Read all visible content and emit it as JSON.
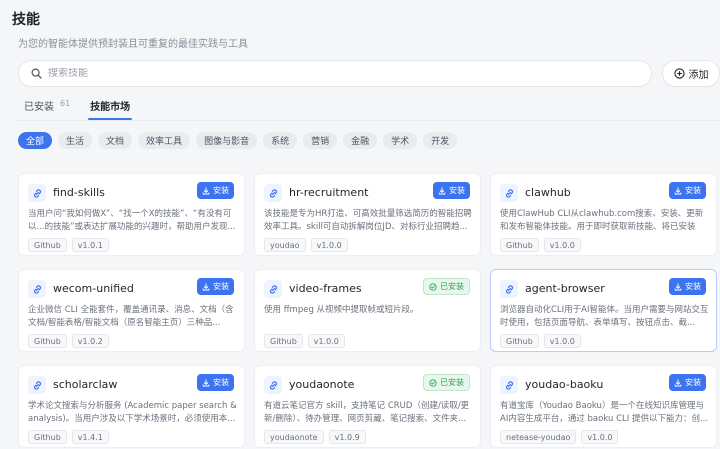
{
  "header": {
    "title": "技能",
    "subtitle": "为您的智能体提供预封装且可重复的最佳实践与工具"
  },
  "search": {
    "placeholder": "搜索技能",
    "value": ""
  },
  "add_button": {
    "label": "添加",
    "icon": "plus-circle-icon"
  },
  "tabs": [
    {
      "label": "已安装",
      "count": "61",
      "active": false
    },
    {
      "label": "技能市场",
      "count": "",
      "active": true
    }
  ],
  "categories": [
    "全部",
    "生活",
    "文档",
    "效率工具",
    "图像与影音",
    "系统",
    "营销",
    "金融",
    "学术",
    "开发"
  ],
  "selected_category": "全部",
  "labels": {
    "install": "安装",
    "installed": "已安装"
  },
  "colors": {
    "accent": "#3b73f0",
    "installed_green": "#2ea05a"
  },
  "cards": [
    {
      "name": "find-skills",
      "desc": "当用户问“我如何做X”、“找一个X的技能”、“有没有可以...的技能”或表达扩展功能的兴趣时，帮助用户发现...",
      "source": "Github",
      "version": "v1.0.1",
      "status": "install"
    },
    {
      "name": "hr-recruitment",
      "desc": "该技能是专为HR打造、可高效批量筛选简历的智能招聘效率工具。skill可自动拆解岗位JD、对标行业招聘趋...",
      "source": "youdao",
      "version": "v1.0.0",
      "status": "install"
    },
    {
      "name": "clawhub",
      "desc": "使用ClawHub CLI从clawhub.com搜索、安装、更新和发布智能体技能。用于即时获取新技能、将已安装技...",
      "source": "Github",
      "version": "v1.0.0",
      "status": "install"
    },
    {
      "name": "wecom-unified",
      "desc": "企业微信 CLI 全能套件，覆盖通讯录、消息、文档（含文档/智能表格/智能文档（原名智能主页）三种品...",
      "source": "Github",
      "version": "v1.0.2",
      "status": "install"
    },
    {
      "name": "video-frames",
      "desc": "使用 ffmpeg 从视频中提取帧或短片段。",
      "source": "Github",
      "version": "v1.0.0",
      "status": "installed"
    },
    {
      "name": "agent-browser",
      "desc": "浏览器自动化CLI用于AI智能体。当用户需要与网站交互时使用，包括页面导航、表单填写、按钮点击、截...",
      "source": "Github",
      "version": "v1.0.0",
      "status": "install"
    },
    {
      "name": "scholarclaw",
      "desc": "学术论文搜索与分析服务 (Academic paper search & analysis)。当用户涉及以下学术场景时，必须使用本...",
      "source": "Github",
      "version": "v1.4.1",
      "status": "install"
    },
    {
      "name": "youdaonote",
      "desc": "有道云笔记官方 skill，支持笔记 CRUD（创建/读取/更新/删除）、待办管理、网页剪藏、笔记搜索、文件夹...",
      "source": "youdaonote",
      "version": "v1.0.9",
      "status": "installed"
    },
    {
      "name": "youdao-baoku",
      "desc": "有道宝库（Youdao Baoku）是一个在线知识库管理与AI内容生成平台，通过 baoku CLI 提供以下能力：创...",
      "source": "netease-youdao",
      "version": "v1.0.0",
      "status": "install"
    }
  ]
}
